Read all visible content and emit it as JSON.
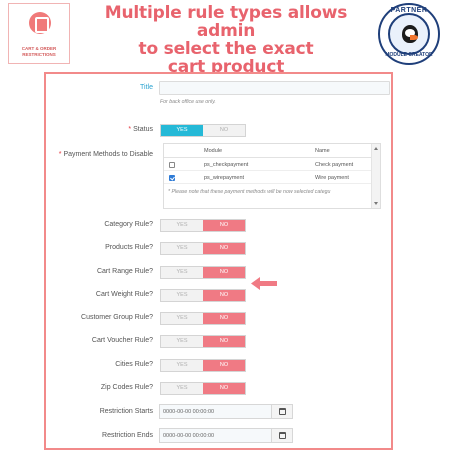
{
  "header": {
    "logo_text_line1": "CART & ORDER",
    "logo_text_line2": "RESTRICTIONS",
    "headline_line1": "Multiple rule types allows admin",
    "headline_line2": "to select the exact",
    "headline_line3": "cart product",
    "badge_top": "PARTNER",
    "badge_bottom": "MODULE CREATOR"
  },
  "form": {
    "title_label": "Title",
    "title_value": "",
    "title_help": "For back office use only.",
    "status_label": "Status",
    "status_yes": "YES",
    "status_no": "NO",
    "payment_label": "Payment Methods to Disable",
    "payment_table": {
      "col_module": "Module",
      "col_name": "Name",
      "rows": [
        {
          "module": "ps_checkpayment",
          "name": "Check payment",
          "checked": false
        },
        {
          "module": "ps_wirepayment",
          "name": "Wire payment",
          "checked": true
        }
      ]
    },
    "payment_help": "* Please note that these payment methods will be now selected categu",
    "rules": [
      {
        "label": "Category Rule?",
        "yes": "YES",
        "no": "NO"
      },
      {
        "label": "Products Rule?",
        "yes": "YES",
        "no": "NO"
      },
      {
        "label": "Cart Range Rule?",
        "yes": "YES",
        "no": "NO"
      },
      {
        "label": "Cart Weight Rule?",
        "yes": "YES",
        "no": "NO"
      },
      {
        "label": "Customer Group Rule?",
        "yes": "YES",
        "no": "NO"
      },
      {
        "label": "Cart Voucher Rule?",
        "yes": "YES",
        "no": "NO"
      },
      {
        "label": "Cities Rule?",
        "yes": "YES",
        "no": "NO"
      },
      {
        "label": "Zip Codes Rule?",
        "yes": "YES",
        "no": "NO"
      }
    ],
    "restriction_starts_label": "Restriction Starts",
    "restriction_starts_value": "0000-00-00 00:00:00",
    "restriction_ends_label": "Restriction Ends",
    "restriction_ends_value": "0000-00-00 00:00:00"
  },
  "colors": {
    "accent_red": "#f07a84",
    "accent_blue": "#25b9d7",
    "headline": "#e8636d",
    "panel_border": "#f28a8a"
  },
  "icons": {
    "calendar": "calendar-icon",
    "pointer": "arrow-left-icon"
  }
}
